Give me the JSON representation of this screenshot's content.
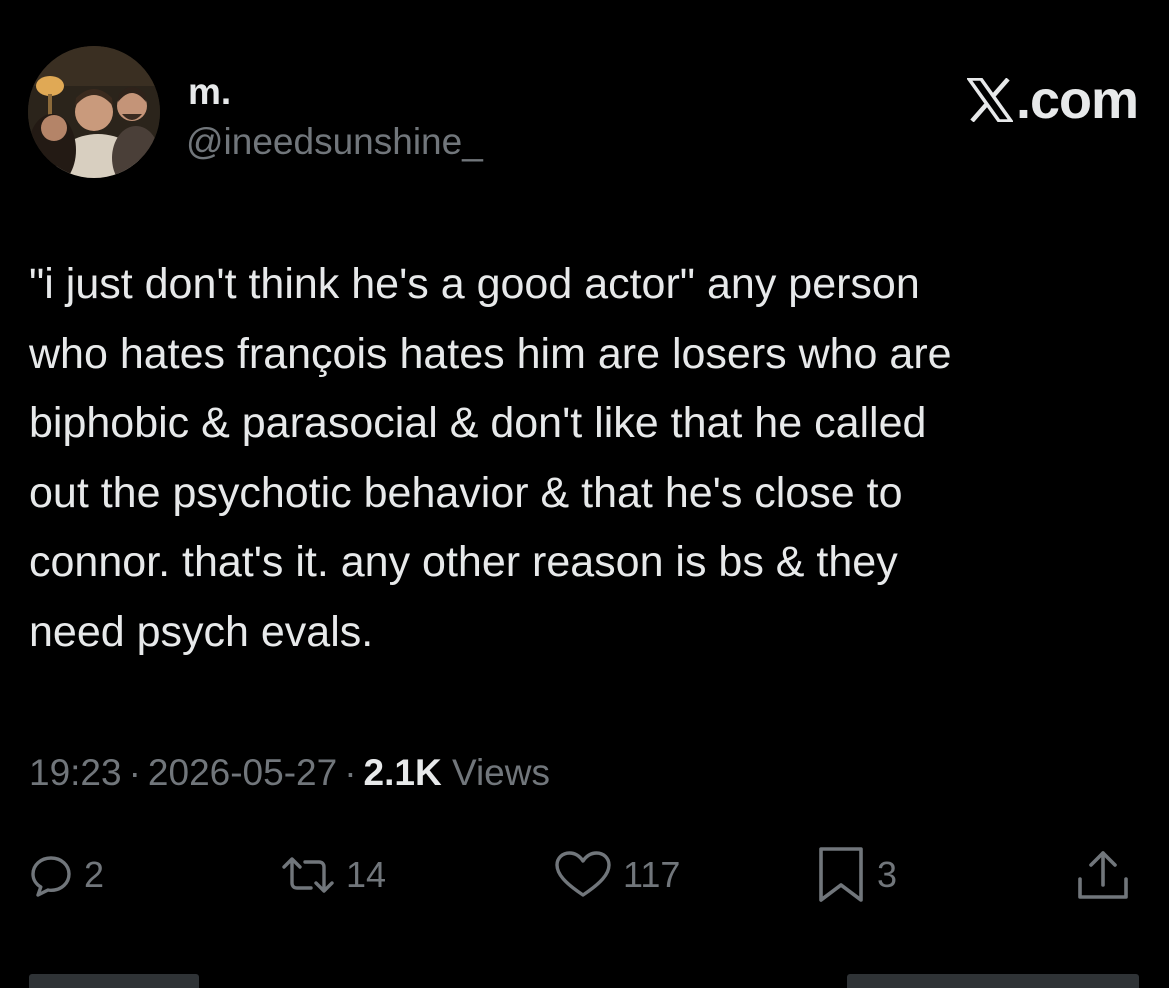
{
  "author": {
    "display_name": "m.",
    "handle": "@ineedsunshine_"
  },
  "brand": {
    "text": ".com"
  },
  "tweet": {
    "lines": [
      "\"i just don't think he's a good actor\" any person",
      "who hates françois hates him are losers who are",
      "biphobic & parasocial & don't like that he called",
      "out the psychotic behavior & that he's close to",
      "connor. that's it. any other reason is bs & they",
      "need psych evals."
    ]
  },
  "meta": {
    "time": "19:23",
    "separator": "·",
    "date": "2026-05-27",
    "views_count": "2.1K",
    "views_label": "Views"
  },
  "actions": {
    "reply": {
      "icon": "reply-icon",
      "count": "2"
    },
    "repost": {
      "icon": "repost-icon",
      "count": "14"
    },
    "like": {
      "icon": "heart-icon",
      "count": "117"
    },
    "bookmark": {
      "icon": "bookmark-icon",
      "count": "3"
    },
    "share": {
      "icon": "share-icon"
    }
  },
  "colors": {
    "background": "#000000",
    "primary_text": "#e7e9ea",
    "secondary_text": "#71767b"
  }
}
